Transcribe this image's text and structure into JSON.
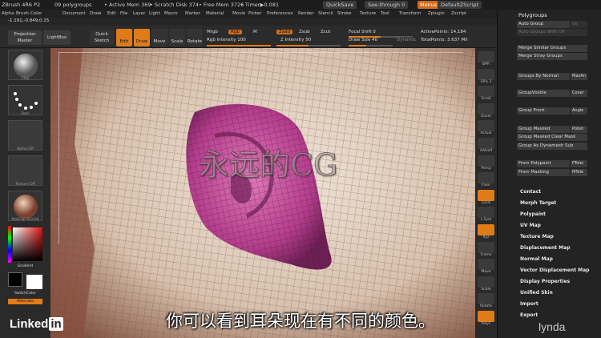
{
  "titlebar": {
    "app": "ZBrush 4R6 P2",
    "polygroups": "09 polygroups",
    "active_mem": "• Active Mem 369",
    "scratch_disk": "• Scratch Disk 374",
    "free_mem": "• Free Mem 3726",
    "timer": "• Timer▶0.081",
    "quicksave": "QuickSave",
    "see_through": "See-through  0",
    "menus": "Menus",
    "default_script": "DefaultZScript"
  },
  "menubar": {
    "items": [
      "Alpha",
      "Brush",
      "Color",
      "Document",
      "Draw",
      "Edit",
      "File",
      "Layer",
      "Light",
      "Macro",
      "Marker",
      "Material",
      "Movie",
      "Picker",
      "Preferences",
      "Render",
      "Stencil",
      "Stroke",
      "Texture",
      "Tool",
      "Transform",
      "Zplugin",
      "Zscript"
    ]
  },
  "coords": "-1.191,-0.849,0.15",
  "toolbar": {
    "projection_master": "Projection Master",
    "lightbox": "LightBox",
    "quick_sketch": "Quick Sketch",
    "edit": "Edit",
    "draw": "Draw",
    "move": "Move",
    "scale": "Scale",
    "rotate": "Rotate",
    "mrgb": "Mrgb",
    "rgb": "Rgb",
    "m": "M",
    "zadd": "Zadd",
    "zsub": "Zsub",
    "zcut": "Zcut",
    "rgb_intensity": "Rgb Intensity 100",
    "z_intensity": "Z Intensity 50",
    "focal_shift": "Focal Shift 0",
    "draw_size": "Draw Size 40",
    "dynamic": "Dynamic",
    "active_points": "ActivePoints: 14,184",
    "total_points": "TotalPoints: 3.637 Mil",
    "rgb_intensity_value": 1.0,
    "z_intensity_value": 0.5,
    "focal_shift_value": 0.5,
    "draw_size_value": 0.4
  },
  "left_shelf": {
    "labels": [
      "Clay",
      "Dots",
      "Alpha Off",
      "Texture Off",
      "MatCap Skin06",
      "Gradient",
      "SwitchColor",
      "Alternate"
    ]
  },
  "right_shelf": {
    "labels": [
      "BPR",
      "SPix 3",
      "Scroll",
      "Zoom",
      "Actual",
      "AAHalf",
      "Persp",
      "Floor",
      "Local",
      "L.Sym",
      "Xyz",
      "Frame",
      "Move",
      "Scale",
      "Rotate",
      "PolyF"
    ]
  },
  "palette": {
    "title": "Polygroups",
    "buttons": [
      {
        "label": "Auto Group",
        "extra": "Uv Groups"
      },
      {
        "label": "Auto Groups With UV",
        "extra": ""
      },
      {
        "label": "Merge Similar Groups",
        "extra": ""
      },
      {
        "label": "Merge Stray Groups",
        "extra": ""
      },
      {
        "label": "Groups By Normal",
        "extra": "MaxAn"
      },
      {
        "label": "GroupVisible",
        "extra": "Cover Clstr"
      },
      {
        "label": "Group Front",
        "extra": "Angle Additi"
      },
      {
        "label": "Group Masked",
        "extra": "Polish"
      },
      {
        "label": "Group Masked Clear Mask",
        "extra": ""
      },
      {
        "label": "Group As Dynamesh Sub",
        "extra": ""
      },
      {
        "label": "From Polypaint",
        "extra": "PTolei"
      },
      {
        "label": "From Masking",
        "extra": "MTole"
      }
    ],
    "menu_items": [
      "Contact",
      "Morph Target",
      "Polypaint",
      "UV Map",
      "Texture Map",
      "Displacement Map",
      "Normal Map",
      "Vector Displacement Map",
      "Display Properties",
      "Unified Skin",
      "Import",
      "Export"
    ]
  },
  "watermark": "永远的CG",
  "subtitle": "你可以看到耳朵现在有不同的颜色。",
  "branding": {
    "linkedin": "Linked",
    "in": "in",
    "lynda": "lynda"
  },
  "colors": {
    "accent": "#e07b1a",
    "polygroup": "#b43c8c",
    "skin": "#d9c6b4"
  }
}
